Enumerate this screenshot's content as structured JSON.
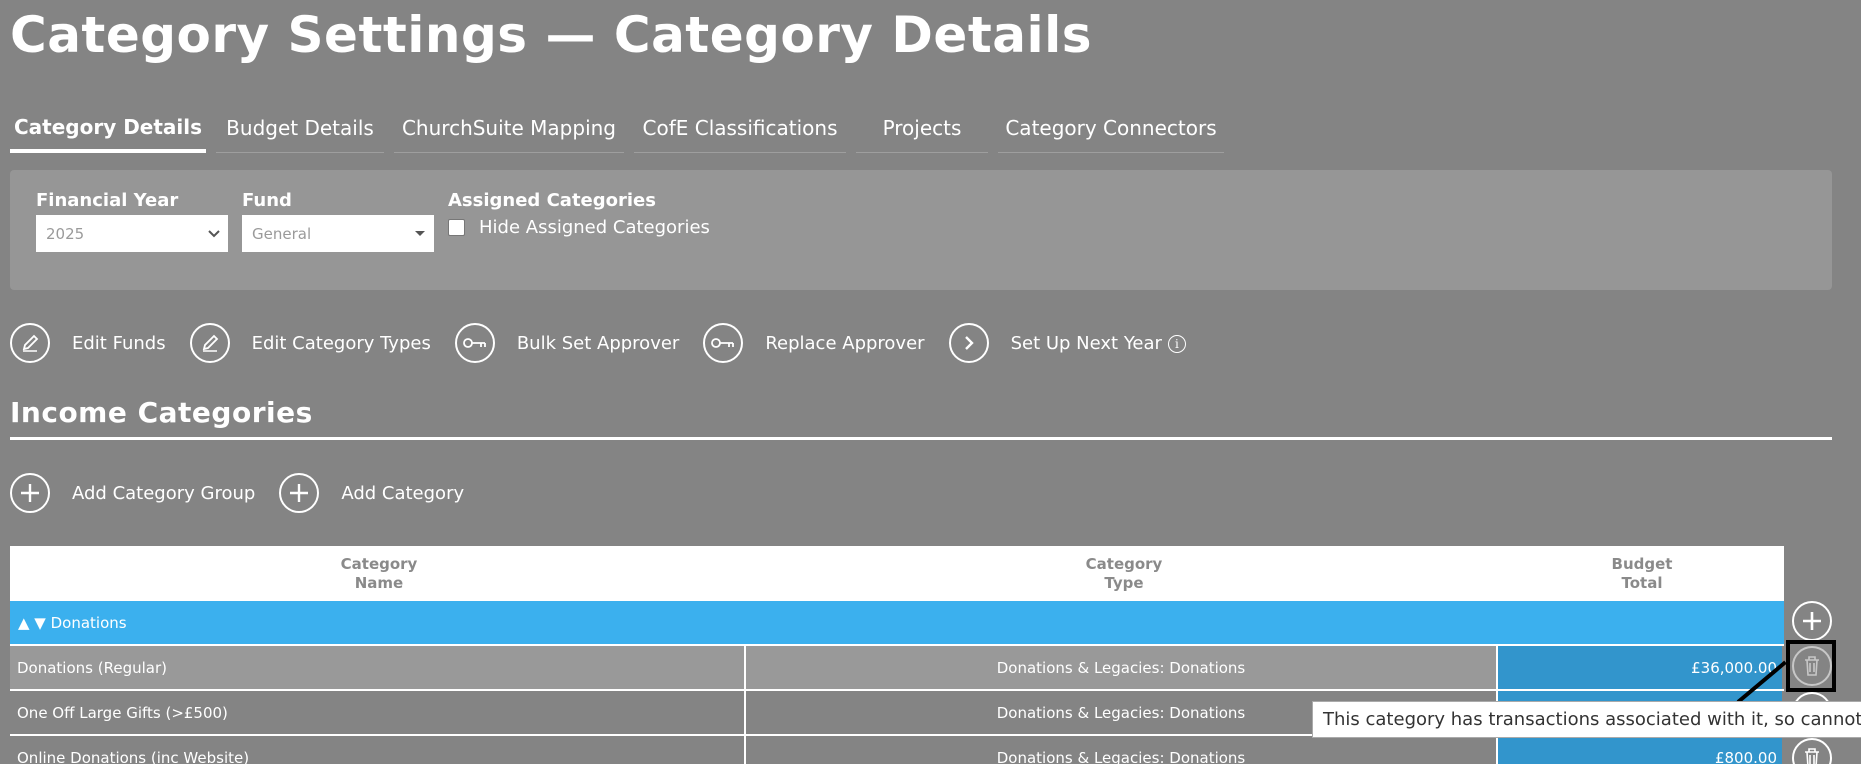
{
  "page": {
    "title": "Category Settings — Category Details"
  },
  "tabs": [
    {
      "label": "Category Details",
      "active": true
    },
    {
      "label": "Budget Details",
      "active": false
    },
    {
      "label": "ChurchSuite Mapping",
      "active": false
    },
    {
      "label": "CofE Classifications",
      "active": false
    },
    {
      "label": "Projects",
      "active": false
    },
    {
      "label": "Category Connectors",
      "active": false
    }
  ],
  "filters": {
    "financial_year": {
      "label": "Financial Year",
      "value": "2025"
    },
    "fund": {
      "label": "Fund",
      "value": "General"
    },
    "assigned": {
      "label": "Assigned Categories",
      "checkbox_label": "Hide Assigned Categories",
      "checked": false
    }
  },
  "actions": {
    "edit_funds": "Edit Funds",
    "edit_category_types": "Edit Category Types",
    "bulk_set_approver": "Bulk Set Approver",
    "replace_approver": "Replace Approver",
    "set_up_next_year": "Set Up Next Year",
    "info_glyph": "i"
  },
  "income": {
    "section_title": "Income Categories",
    "add_category_group": "Add Category Group",
    "add_category": "Add Category"
  },
  "table": {
    "headers": {
      "name_line1": "Category",
      "name_line2": "Name",
      "type_line1": "Category",
      "type_line2": "Type",
      "budget_line1": "Budget",
      "budget_line2": "Total"
    },
    "group": {
      "label": "▲ ▼ Donations"
    },
    "rows": [
      {
        "name": "Donations (Regular)",
        "type": "Donations & Legacies: Donations",
        "budget": "£36,000.00"
      },
      {
        "name": "One Off Large Gifts (>£500)",
        "type": "Donations & Legacies: Donations",
        "budget": ""
      },
      {
        "name": "Online Donations (inc Website)",
        "type": "Donations & Legacies: Donations",
        "budget": "£800.00"
      }
    ]
  },
  "tooltip": {
    "text": "This category has transactions associated with it, so cannot be deleted"
  },
  "colors": {
    "background": "#848484",
    "group_row": "#3bb0ee",
    "budget_cell": "#3295cc",
    "highlight": "#000000"
  }
}
